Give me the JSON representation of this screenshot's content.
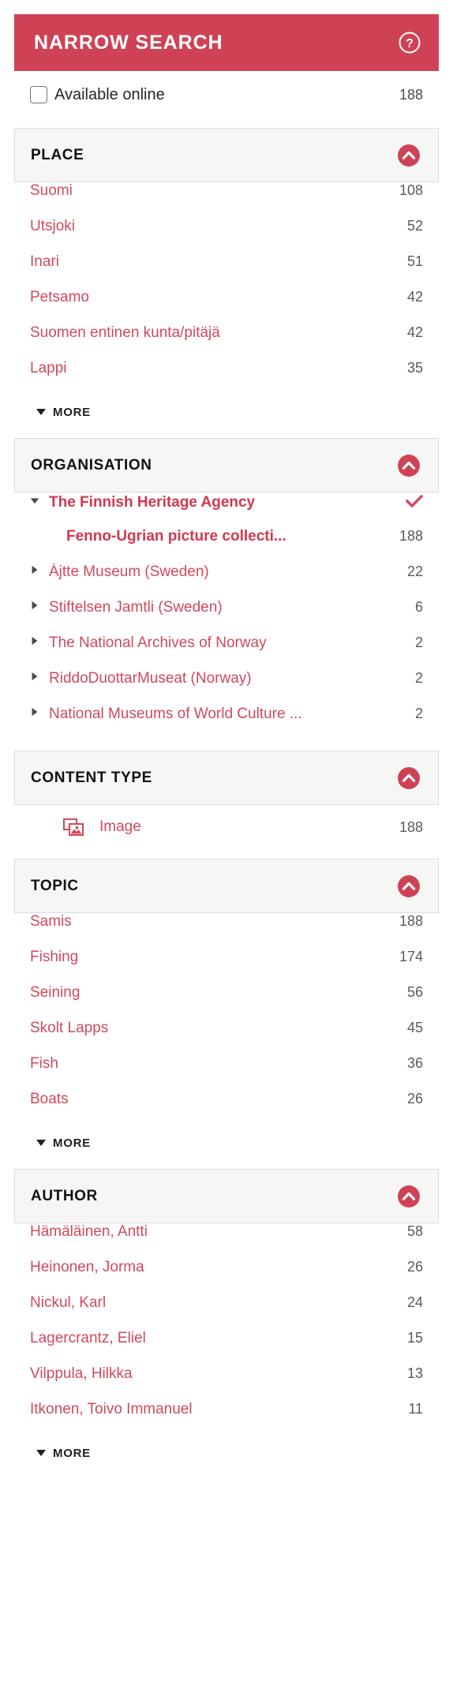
{
  "header": {
    "title": "NARROW SEARCH",
    "help_icon": "help-circle-icon"
  },
  "available_online": {
    "label": "Available online",
    "count": "188",
    "checked": false
  },
  "colors": {
    "brand_red": "#cf4255",
    "link_red": "#d0495c",
    "facet_head_bg": "#f6f7f5",
    "count_gray": "#555b60"
  },
  "more_label": "MORE",
  "facets": [
    {
      "title": "PLACE",
      "collapse_icon": "chevron-up-circle-icon",
      "items": [
        {
          "label": "Suomi",
          "count": "108"
        },
        {
          "label": "Utsjoki",
          "count": "52"
        },
        {
          "label": "Inari",
          "count": "51"
        },
        {
          "label": "Petsamo",
          "count": "42"
        },
        {
          "label": "Suomen entinen kunta/pitäjä",
          "count": "42"
        },
        {
          "label": "Lappi",
          "count": "35"
        }
      ],
      "has_more": true
    },
    {
      "title": "ORGANISATION",
      "collapse_icon": "chevron-up-circle-icon",
      "items": [
        {
          "label": "The Finnish Heritage Agency",
          "count": "",
          "selected": true,
          "expanded": true,
          "checkmark": true
        },
        {
          "label": "Fenno-Ugrian picture collecti...",
          "count": "188",
          "child": true
        },
        {
          "label": "Ájtte Museum (Sweden)",
          "count": "22",
          "expandable": true
        },
        {
          "label": "Stiftelsen Jamtli (Sweden)",
          "count": "6",
          "expandable": true
        },
        {
          "label": "The National Archives of Norway",
          "count": "2",
          "expandable": true
        },
        {
          "label": "RiddoDuottarMuseat (Norway)",
          "count": "2",
          "expandable": true
        },
        {
          "label": "National Museums of World Culture ...",
          "count": "2",
          "expandable": true
        }
      ],
      "has_more": false
    },
    {
      "title": "CONTENT TYPE",
      "collapse_icon": "chevron-up-circle-icon",
      "items": [
        {
          "label": "Image",
          "count": "188",
          "icon": "image-stack-icon"
        }
      ],
      "has_more": false
    },
    {
      "title": "TOPIC",
      "collapse_icon": "chevron-up-circle-icon",
      "items": [
        {
          "label": "Samis",
          "count": "188"
        },
        {
          "label": "Fishing",
          "count": "174"
        },
        {
          "label": "Seining",
          "count": "56"
        },
        {
          "label": "Skolt Lapps",
          "count": "45"
        },
        {
          "label": "Fish",
          "count": "36"
        },
        {
          "label": "Boats",
          "count": "26"
        }
      ],
      "has_more": true
    },
    {
      "title": "AUTHOR",
      "collapse_icon": "chevron-up-circle-icon",
      "items": [
        {
          "label": "Hämäläinen, Antti",
          "count": "58"
        },
        {
          "label": "Heinonen, Jorma",
          "count": "26"
        },
        {
          "label": "Nickul, Karl",
          "count": "24"
        },
        {
          "label": "Lagercrantz, Eliel",
          "count": "15"
        },
        {
          "label": "Vilppula, Hilkka",
          "count": "13"
        },
        {
          "label": "Itkonen, Toivo Immanuel",
          "count": "11"
        }
      ],
      "has_more": true
    }
  ]
}
